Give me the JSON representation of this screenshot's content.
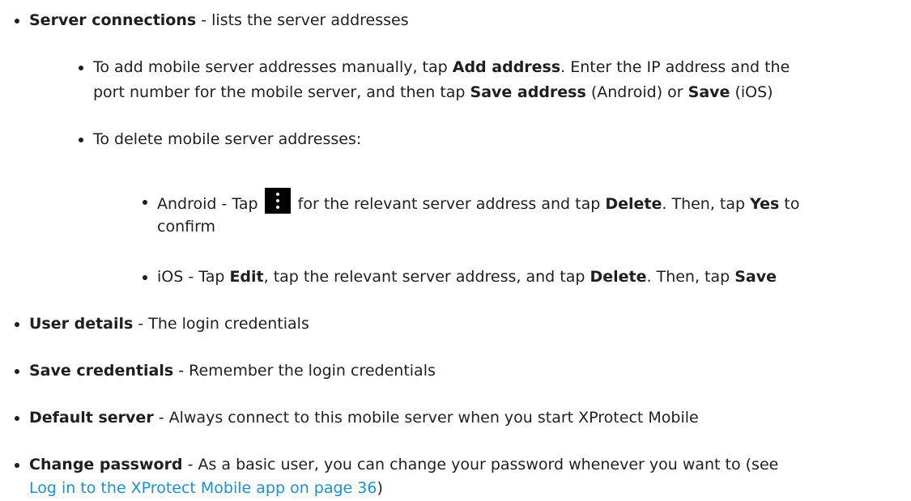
{
  "server_connections": {
    "label": "Server connections",
    "text": " - lists the server addresses"
  },
  "add_address": {
    "t1": "To add mobile server addresses manually, tap ",
    "b1": "Add address",
    "t2": ". Enter the IP address and the",
    "t3": "port number for the mobile server, and then tap ",
    "b2": "Save address",
    "t4": " (Android) or ",
    "b3": "Save",
    "t5": " (iOS)"
  },
  "delete_addresses": {
    "text": "To delete mobile server addresses:"
  },
  "android": {
    "t1": "Android - Tap ",
    "icon": "kebab-menu-icon",
    "t2": " for the relevant server address and tap ",
    "b1": "Delete",
    "t3": ". Then, tap ",
    "b2": "Yes",
    "t4": " to",
    "t5": "confirm"
  },
  "ios": {
    "t1": "iOS - Tap ",
    "b1": "Edit",
    "t2": ", tap the relevant server address, and tap ",
    "b2": "Delete",
    "t3": ". Then, tap ",
    "b3": "Save"
  },
  "user_details": {
    "label": "User details",
    "text": " - The login credentials"
  },
  "save_credentials": {
    "label": "Save credentials",
    "text": " - Remember the login credentials"
  },
  "default_server": {
    "label": "Default server",
    "text": " - Always connect to this mobile server when you start XProtect Mobile"
  },
  "change_password": {
    "label": "Change password",
    "text": " - As a basic user, you can change your password whenever you want to (see",
    "link": "Log in to the XProtect Mobile app on page 36",
    "close": ")"
  },
  "colors": {
    "text": "#1f1f1f",
    "link": "#1a90d8",
    "icon_bg": "#000000"
  }
}
